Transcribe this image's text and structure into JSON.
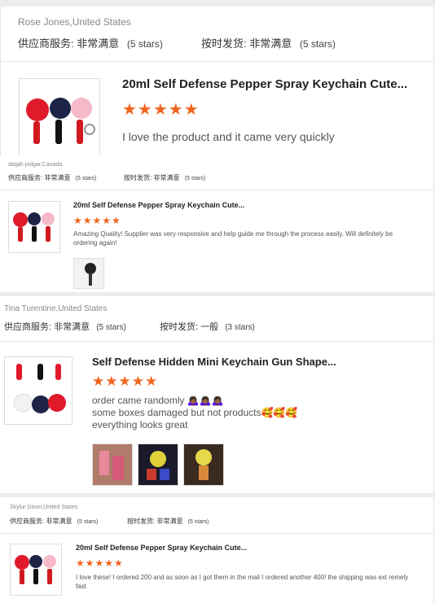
{
  "reviews": [
    {
      "reviewer": "Rose Jones,United States",
      "supplier_label": "供应商服务:",
      "supplier_value": "非常满意",
      "supplier_stars": "(5 stars)",
      "shipping_label": "按时发货:",
      "shipping_value": "非常满意",
      "shipping_stars": "(5 stars)",
      "product_title": "20ml Self Defense Pepper Spray Keychain Cute...",
      "rating": 5,
      "stars_text": "★★★★★",
      "comment": "I love the product and it came very quickly"
    },
    {
      "reviewer": "daijah polgar,Canada",
      "supplier_label": "供应商服务:",
      "supplier_value": "非常满意",
      "supplier_stars": "(5 stars)",
      "shipping_label": "按时发货:",
      "shipping_value": "非常满意",
      "shipping_stars": "(5 stars)",
      "product_title": "20ml Self Defense Pepper Spray Keychain Cute...",
      "rating": 5,
      "stars_text": "★★★★★",
      "comment": "Amazing Quality! Supplier was very responsive and help guide me through the process easily. Will definitely be ordering again!"
    },
    {
      "reviewer": "Tina Turentine,United States",
      "supplier_label": "供应商服务:",
      "supplier_value": "非常满意",
      "supplier_stars": "(5 stars)",
      "shipping_label": "按时发货:",
      "shipping_value": "一般",
      "shipping_stars": "(3 stars)",
      "product_title": "Self Defense Hidden Mini Keychain Gun Shape...",
      "rating": 5,
      "stars_text": "★★★★★",
      "comment_lines": [
        "order came randomly 🙇🏾‍♀️🙇🏾‍♀️🙇🏾‍♀️",
        "some boxes damaged but not products🥰🥰🥰",
        "everything looks great"
      ]
    },
    {
      "reviewer": "Skylur Dixon,United States",
      "supplier_label": "供应商服务:",
      "supplier_value": "非常满意",
      "supplier_stars": "(5 stars)",
      "shipping_label": "按时发货:",
      "shipping_value": "非常满意",
      "shipping_stars": "(5 stars)",
      "product_title": "20ml Self Defense Pepper Spray Keychain Cute...",
      "rating": 5,
      "stars_text": "★★★★★",
      "comment": "I love these! I ordered 200 and as soon as I got them in the mail I ordered another 400! the shipping was ext remely fast"
    }
  ],
  "colors": {
    "star": "#f0641e",
    "separator": "#ececec",
    "border": "#e3e3e3"
  },
  "icons": [
    "star-icon",
    "product-thumbnail",
    "review-photo"
  ]
}
